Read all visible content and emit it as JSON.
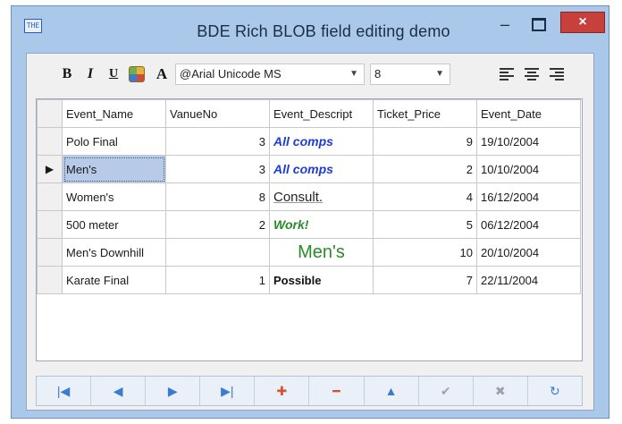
{
  "window": {
    "title": "BDE Rich BLOB field editing demo",
    "app_icon_text": "THE",
    "minimize_glyph": "–",
    "close_glyph": "×"
  },
  "toolbar": {
    "bold_label": "B",
    "italic_label": "I",
    "underline_label": "U",
    "font_label": "A",
    "font_combo_value": "@Arial Unicode MS",
    "size_combo_value": "8",
    "dropdown_glyph": "▼"
  },
  "grid": {
    "columns": [
      "Event_Name",
      "VanueNo",
      "Event_Descript",
      "Ticket_Price",
      "Event_Date"
    ],
    "current_row_indicator": "▶",
    "rows": [
      {
        "name": "Polo Final",
        "venue": "3",
        "desc": "All comps",
        "price": "9",
        "date": "19/10/2004"
      },
      {
        "name": "Men's",
        "venue": "3",
        "desc": "All comps",
        "price": "2",
        "date": "10/10/2004"
      },
      {
        "name": "Women's",
        "venue": "8",
        "desc": "Consult.",
        "price": "4",
        "date": "16/12/2004"
      },
      {
        "name": "500 meter",
        "venue": "2",
        "desc": "Work!",
        "price": "5",
        "date": "06/12/2004"
      },
      {
        "name": "Men's Downhill",
        "venue": "",
        "desc": "Men's",
        "price": "10",
        "date": "20/10/2004"
      },
      {
        "name": "Karate Final",
        "venue": "1",
        "desc": "Possible",
        "price": "7",
        "date": "22/11/2004"
      }
    ]
  },
  "navigator": {
    "first": "|◀",
    "prior": "◀",
    "next": "▶",
    "last": "▶|",
    "insert": "✚",
    "delete": "━",
    "edit": "▲",
    "post": "✔",
    "cancel": "✖",
    "refresh": "↻"
  },
  "colors": {
    "window_frame": "#aac8ea",
    "close_button": "#c8403c",
    "selected_cell": "#b7cbe8",
    "rich_blue": "#1f3cd8",
    "rich_green": "#2a8a2a"
  }
}
